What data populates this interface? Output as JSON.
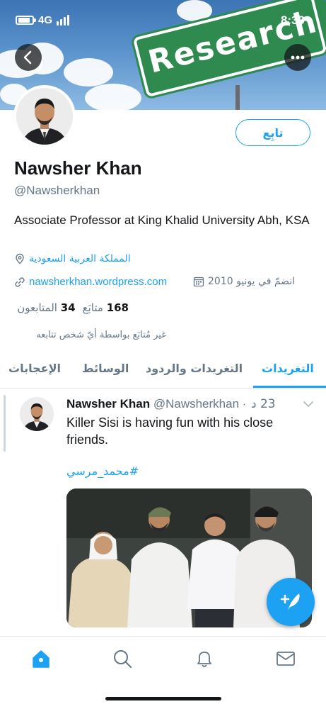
{
  "status_bar": {
    "network": "4G",
    "time": "8:39"
  },
  "banner": {
    "sign_text": "Research"
  },
  "profile": {
    "follow_label": "تابِع",
    "name": "Nawsher Khan",
    "handle": "@Nawsherkhan",
    "bio": "Associate Professor at King Khalid University Abh, KSA",
    "location": "المملكة العربية السعودية",
    "website": "nawsherkhan.wordpress.com",
    "joined": "انضمّ في يونيو 2010",
    "following_count": "168",
    "following_label": "متابَع",
    "followers_count": "34",
    "followers_label": "المتابعون",
    "not_followed_text": "غير مُتابَع بواسطة أيّ شخص تتابعه"
  },
  "tabs": [
    {
      "label": "التغريدات",
      "active": true
    },
    {
      "label": "التغريدات والردود",
      "active": false
    },
    {
      "label": "الوسائط",
      "active": false
    },
    {
      "label": "الإعجابات",
      "active": false
    }
  ],
  "tweet": {
    "name": "Nawsher Khan",
    "handle": "@Nawsherkhan",
    "separator": "·",
    "time": "23 د",
    "text": "Killer Sisi is having fun with his close friends.",
    "hashtag": "#محمد_مرسي"
  },
  "bottom_nav": [
    {
      "icon": "home-icon",
      "active": true
    },
    {
      "icon": "search-icon",
      "active": false
    },
    {
      "icon": "bell-icon",
      "active": false
    },
    {
      "icon": "mail-icon",
      "active": false
    }
  ],
  "colors": {
    "accent": "#1da1f2",
    "text": "#14171a",
    "secondary": "#657786",
    "sign_green": "#2f8a4f"
  }
}
